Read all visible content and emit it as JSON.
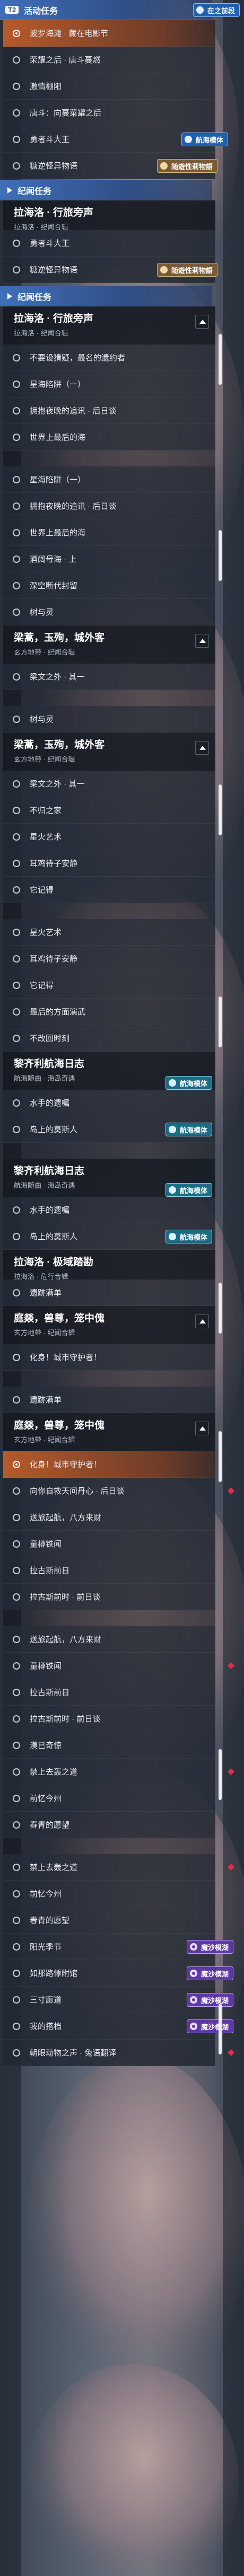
{
  "colors": {
    "header": "#3f6fb9",
    "selected": "#b65a2a",
    "event_badge": "#1f5fb0",
    "tip_badge": "#7a5a34",
    "nav_badge": "#1c6c86",
    "shadow_badge": "#5e39a6"
  },
  "icons": {
    "header_expand": "play-triangle-icon",
    "item_marker": "circle-icon",
    "collapse": "chevron-up-icon",
    "new_marker": "red-diamond-icon"
  },
  "badges": {
    "event": "在之前段",
    "tip": "随遊性莉物語",
    "nav": "航海模体",
    "shadow": "魔沙模湖"
  },
  "p1": {
    "h_event": "活动任务",
    "h_event_key": "T2",
    "items": [
      "波罗海滩 · 藏在电影节",
      "荣耀之后 · 唐斗蔓燃",
      "激情棚阳",
      "唐斗：向蔓菜罐之后",
      "勇者斗大王",
      "糖逆怪异物语"
    ],
    "h_story": "纪闻任务",
    "title": "拉海洛 · 行旅旁声",
    "title_sub": "拉海洛 · 纪闻合辑",
    "after": [
      "勇者斗大王",
      "糖逆怪异物语"
    ]
  },
  "p2": {
    "h_story": "纪闻任务",
    "title": "拉海洛 · 行旅旁声",
    "title_sub": "拉海洛 · 纪闻合辑",
    "items": [
      "不要设猜疑，最名的遗约者",
      "星海陷阱（一）",
      "拥抱夜晚的追讯 · 后日谈",
      "世界上最后的海"
    ]
  },
  "p3": {
    "items": [
      "星海陷阱（一）",
      "拥抱夜晚的追讯 · 后日谈",
      "世界上最后的海",
      "酒阔母海 · 上",
      "深空断代封留",
      "树与灵"
    ],
    "title": "梁蒿，玉殉，城外客",
    "title_sub": "玄方地带 · 纪闻合辑",
    "after": [
      "梁文之外 · 其一"
    ]
  },
  "p4": {
    "items": [
      "树与灵"
    ],
    "title": "梁蒿，玉殉，城外客",
    "title_sub": "玄方地带 · 纪闻合辑",
    "after": [
      "梁文之外 · 其一",
      "不归之家",
      "星火艺术",
      "耳鸡待子安静",
      "它记得"
    ]
  },
  "p5": {
    "items": [
      "星火艺术",
      "耳鸡待子安静",
      "它记得",
      "最后的方面演武",
      "不改回时刻"
    ],
    "title": "黎齐利航海日志",
    "title_sub": "航海随曲 · 海岛奇遇",
    "after": [
      "水手的遗嘱",
      "岛上的莫斯人"
    ]
  },
  "p6": {
    "title": "黎齐利航海日志",
    "title_sub": "航海随曲 · 海岛奇遇",
    "items": [
      "水手的遗嘱",
      "岛上的莫斯人"
    ],
    "title2": "拉海洛 · 极域踏勘",
    "title2_sub": "拉海洛 · 危行合辑",
    "items2": [
      "遗跡满单"
    ],
    "title3": "庭燚，兽尊，笼中傀",
    "title3_sub": "玄方地带 · 纪闻合辑",
    "items3": [
      "化身！城市守护者！"
    ]
  },
  "p7": {
    "items": [
      "遗跡满单"
    ],
    "title": "庭燚，兽尊，笼中傀",
    "title_sub": "玄方地带 · 纪闻合辑",
    "after": [
      "化身！城市守护者！",
      "向你自救天问丹心 · 后日谈",
      "送旅起航，八方来财",
      "童樽铁闻",
      "拉古斯前日",
      "拉古斯前时 · 前日谈"
    ]
  },
  "p8": {
    "items": [
      "送旅起航，八方来财",
      "童樽铁闻",
      "拉古斯前日",
      "拉古斯前时 · 前日谈",
      "漠已奇惊",
      "禁上去轰之道",
      "前忆今州",
      "春青的愿望"
    ]
  },
  "p9": {
    "items": [
      "禁上去轰之道",
      "前忆今州",
      "春青的愿望",
      "阳光季节",
      "如那路悸附馆",
      "三寸廊道",
      "我的搭档",
      "朝眼动物之声 · 兔语翻译"
    ]
  }
}
